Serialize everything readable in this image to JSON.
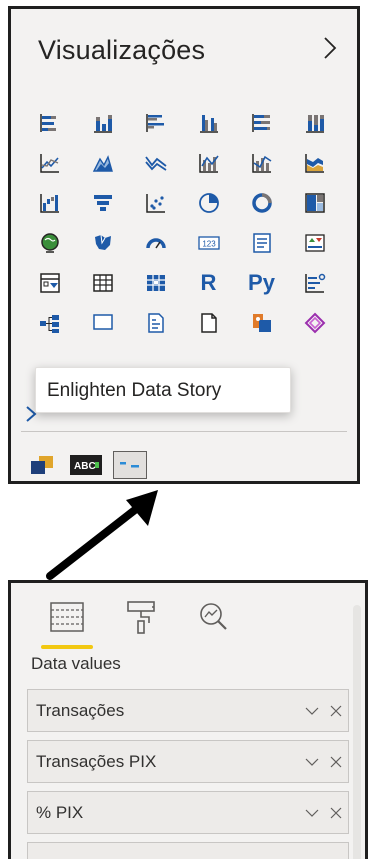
{
  "viz_panel": {
    "title": "Visualizações",
    "tooltip": "Enlighten Data Story",
    "grid_icons": [
      "stacked-bar-icon",
      "stacked-column-icon",
      "clustered-bar-icon",
      "clustered-column-icon",
      "100-stacked-bar-icon",
      "100-stacked-column-icon",
      "line-chart-icon",
      "area-chart-icon",
      "stacked-area-icon",
      "line-column-icon",
      "line-clustered-column-icon",
      "ribbon-chart-icon",
      "waterfall-icon",
      "funnel-icon",
      "scatter-icon",
      "pie-icon",
      "donut-icon",
      "treemap-icon",
      "map-icon",
      "filled-map-icon",
      "gauge-icon",
      "card-icon",
      "multirow-card-icon",
      "kpi-icon",
      "slicer-icon",
      "table-icon",
      "matrix-icon",
      "r-visual-icon",
      "python-visual-icon",
      "key-influencers-icon",
      "decomposition-tree-icon",
      "qa-icon",
      "smart-narrative-icon",
      "paginated-report-icon",
      "arcgis-map-icon",
      "power-apps-icon"
    ],
    "custom_icons": [
      "custom-visual-icon",
      "abc-visual-icon",
      "enlighten-data-story-icon"
    ],
    "r_label": "R",
    "py_label": "Py",
    "card_label": "123"
  },
  "fields_panel": {
    "tabs": [
      "fields-tab-icon",
      "format-tab-icon",
      "analytics-tab-icon"
    ],
    "section_label": "Data values",
    "wells": [
      {
        "name": "Transações"
      },
      {
        "name": "Transações PIX"
      },
      {
        "name": "% PIX"
      }
    ]
  },
  "colors": {
    "accent_yellow": "#f2c811",
    "brand_blue": "#1e5aa8",
    "panel_bg": "#f3f2f1"
  }
}
